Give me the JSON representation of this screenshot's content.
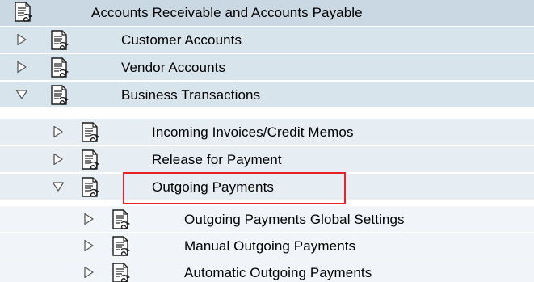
{
  "tree": {
    "root": {
      "label": "Accounts Receivable and Accounts Payable",
      "icon": "document-execute-icon"
    },
    "level1": [
      {
        "label": "Customer Accounts",
        "expanded": false
      },
      {
        "label": "Vendor Accounts",
        "expanded": false
      },
      {
        "label": "Business Transactions",
        "expanded": true
      }
    ],
    "level2": [
      {
        "label": "Incoming Invoices/Credit Memos",
        "expanded": false
      },
      {
        "label": "Release for Payment",
        "expanded": false
      },
      {
        "label": "Outgoing Payments",
        "expanded": true,
        "highlighted": true
      }
    ],
    "level3": [
      {
        "label": "Outgoing Payments Global Settings",
        "expanded": false
      },
      {
        "label": "Manual Outgoing Payments",
        "expanded": false
      },
      {
        "label": "Automatic Outgoing Payments",
        "expanded": false
      }
    ]
  },
  "colors": {
    "highlight_border": "#e8202a",
    "row_level0": "#c9d8e2",
    "row_level1": "#d8e4ec",
    "row_level2": "#e6eef4",
    "row_level3": "#f1f5f9"
  }
}
